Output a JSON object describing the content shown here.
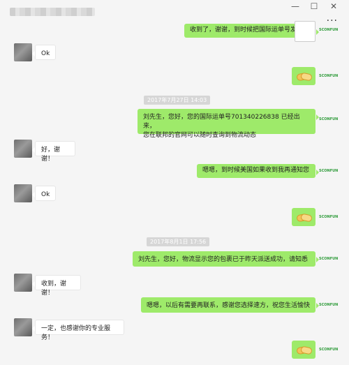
{
  "window": {
    "minimize_glyph": "—",
    "maximize_glyph": "☐",
    "close_glyph": "✕",
    "more_glyph": "···"
  },
  "contact_logo": "SCONFUN",
  "messages": {
    "m1": "收到了，谢谢，到时候把国际运单号发给您",
    "m2": "Ok",
    "t1": "2017年7月27日 14:03",
    "m4": "刘先生，您好，您的国际运单号701340226838 已经出来，\n您在联邦的官网可以随时查询到物流动态",
    "m5": "好，谢谢！",
    "m6": "嗯嗯，到时候美国如果收到我再通知您",
    "m7": "Ok",
    "t2": "2017年8月1日 17:56",
    "m9": "刘先生，您好，物流显示您的包裹已于昨天派送成功，请知悉",
    "m10": "收到，谢谢！",
    "m11": "嗯嗯，以后有需要再联系，感谢您选择速方，祝您生活愉快",
    "m12": "一定，也感谢你的专业服务！"
  }
}
